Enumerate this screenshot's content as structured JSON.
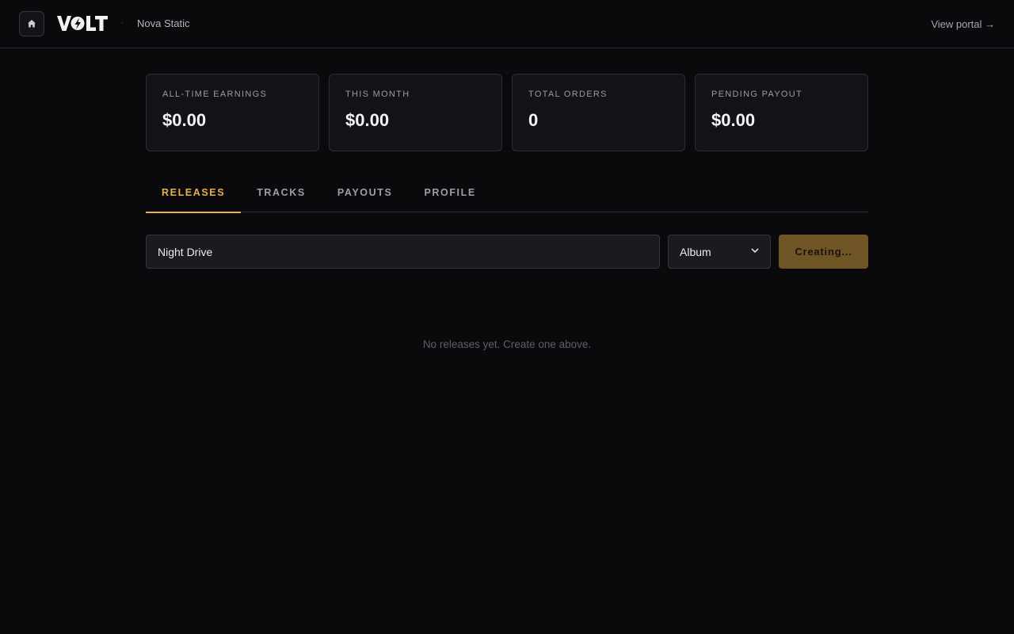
{
  "header": {
    "logo_text": "VOLT",
    "artist_name": "Nova Static",
    "portal_link": "View portal →"
  },
  "stats": [
    {
      "label": "ALL-TIME EARNINGS",
      "value": "$0.00"
    },
    {
      "label": "THIS MONTH",
      "value": "$0.00"
    },
    {
      "label": "TOTAL ORDERS",
      "value": "0"
    },
    {
      "label": "PENDING PAYOUT",
      "value": "$0.00"
    }
  ],
  "tabs": [
    {
      "label": "RELEASES",
      "active": true
    },
    {
      "label": "TRACKS",
      "active": false
    },
    {
      "label": "PAYOUTS",
      "active": false
    },
    {
      "label": "PROFILE",
      "active": false
    }
  ],
  "create_form": {
    "title_value": "Night Drive",
    "type_selected": "Album",
    "submit_label": "Creating..."
  },
  "empty_state": "No releases yet. Create one above.",
  "colors": {
    "background": "#0a0a0c",
    "accent": "#e6b04a",
    "button_busy": "#6f5526"
  },
  "icons": {
    "home": "home-icon",
    "select": "chevron-down-icon"
  }
}
